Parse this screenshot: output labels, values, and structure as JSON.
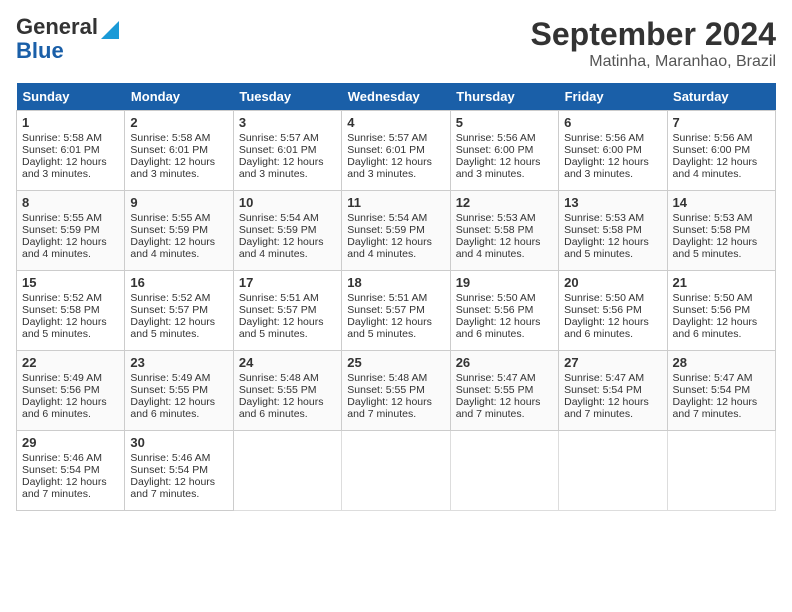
{
  "header": {
    "logo_line1": "General",
    "logo_line2": "Blue",
    "month": "September 2024",
    "location": "Matinha, Maranhao, Brazil"
  },
  "days_of_week": [
    "Sunday",
    "Monday",
    "Tuesday",
    "Wednesday",
    "Thursday",
    "Friday",
    "Saturday"
  ],
  "weeks": [
    [
      {
        "day": 1,
        "sunrise": "5:58 AM",
        "sunset": "6:01 PM",
        "daylight": "12 hours and 3 minutes."
      },
      {
        "day": 2,
        "sunrise": "5:58 AM",
        "sunset": "6:01 PM",
        "daylight": "12 hours and 3 minutes."
      },
      {
        "day": 3,
        "sunrise": "5:57 AM",
        "sunset": "6:01 PM",
        "daylight": "12 hours and 3 minutes."
      },
      {
        "day": 4,
        "sunrise": "5:57 AM",
        "sunset": "6:01 PM",
        "daylight": "12 hours and 3 minutes."
      },
      {
        "day": 5,
        "sunrise": "5:56 AM",
        "sunset": "6:00 PM",
        "daylight": "12 hours and 3 minutes."
      },
      {
        "day": 6,
        "sunrise": "5:56 AM",
        "sunset": "6:00 PM",
        "daylight": "12 hours and 3 minutes."
      },
      {
        "day": 7,
        "sunrise": "5:56 AM",
        "sunset": "6:00 PM",
        "daylight": "12 hours and 4 minutes."
      }
    ],
    [
      {
        "day": 8,
        "sunrise": "5:55 AM",
        "sunset": "5:59 PM",
        "daylight": "12 hours and 4 minutes."
      },
      {
        "day": 9,
        "sunrise": "5:55 AM",
        "sunset": "5:59 PM",
        "daylight": "12 hours and 4 minutes."
      },
      {
        "day": 10,
        "sunrise": "5:54 AM",
        "sunset": "5:59 PM",
        "daylight": "12 hours and 4 minutes."
      },
      {
        "day": 11,
        "sunrise": "5:54 AM",
        "sunset": "5:59 PM",
        "daylight": "12 hours and 4 minutes."
      },
      {
        "day": 12,
        "sunrise": "5:53 AM",
        "sunset": "5:58 PM",
        "daylight": "12 hours and 4 minutes."
      },
      {
        "day": 13,
        "sunrise": "5:53 AM",
        "sunset": "5:58 PM",
        "daylight": "12 hours and 5 minutes."
      },
      {
        "day": 14,
        "sunrise": "5:53 AM",
        "sunset": "5:58 PM",
        "daylight": "12 hours and 5 minutes."
      }
    ],
    [
      {
        "day": 15,
        "sunrise": "5:52 AM",
        "sunset": "5:58 PM",
        "daylight": "12 hours and 5 minutes."
      },
      {
        "day": 16,
        "sunrise": "5:52 AM",
        "sunset": "5:57 PM",
        "daylight": "12 hours and 5 minutes."
      },
      {
        "day": 17,
        "sunrise": "5:51 AM",
        "sunset": "5:57 PM",
        "daylight": "12 hours and 5 minutes."
      },
      {
        "day": 18,
        "sunrise": "5:51 AM",
        "sunset": "5:57 PM",
        "daylight": "12 hours and 5 minutes."
      },
      {
        "day": 19,
        "sunrise": "5:50 AM",
        "sunset": "5:56 PM",
        "daylight": "12 hours and 6 minutes."
      },
      {
        "day": 20,
        "sunrise": "5:50 AM",
        "sunset": "5:56 PM",
        "daylight": "12 hours and 6 minutes."
      },
      {
        "day": 21,
        "sunrise": "5:50 AM",
        "sunset": "5:56 PM",
        "daylight": "12 hours and 6 minutes."
      }
    ],
    [
      {
        "day": 22,
        "sunrise": "5:49 AM",
        "sunset": "5:56 PM",
        "daylight": "12 hours and 6 minutes."
      },
      {
        "day": 23,
        "sunrise": "5:49 AM",
        "sunset": "5:55 PM",
        "daylight": "12 hours and 6 minutes."
      },
      {
        "day": 24,
        "sunrise": "5:48 AM",
        "sunset": "5:55 PM",
        "daylight": "12 hours and 6 minutes."
      },
      {
        "day": 25,
        "sunrise": "5:48 AM",
        "sunset": "5:55 PM",
        "daylight": "12 hours and 7 minutes."
      },
      {
        "day": 26,
        "sunrise": "5:47 AM",
        "sunset": "5:55 PM",
        "daylight": "12 hours and 7 minutes."
      },
      {
        "day": 27,
        "sunrise": "5:47 AM",
        "sunset": "5:54 PM",
        "daylight": "12 hours and 7 minutes."
      },
      {
        "day": 28,
        "sunrise": "5:47 AM",
        "sunset": "5:54 PM",
        "daylight": "12 hours and 7 minutes."
      }
    ],
    [
      {
        "day": 29,
        "sunrise": "5:46 AM",
        "sunset": "5:54 PM",
        "daylight": "12 hours and 7 minutes."
      },
      {
        "day": 30,
        "sunrise": "5:46 AM",
        "sunset": "5:54 PM",
        "daylight": "12 hours and 7 minutes."
      },
      null,
      null,
      null,
      null,
      null
    ]
  ]
}
